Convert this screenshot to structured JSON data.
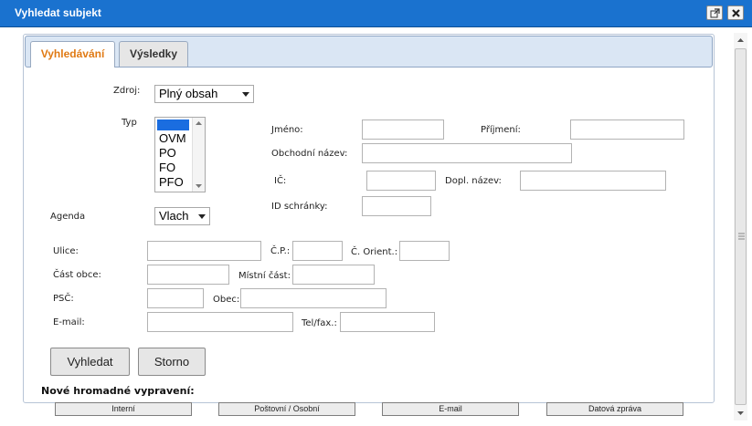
{
  "window": {
    "title": "Vyhledat subjekt"
  },
  "tabs": [
    {
      "label": "Vyhledávání"
    },
    {
      "label": "Výsledky"
    }
  ],
  "form": {
    "zdroj_label": "Zdroj:",
    "zdroj_value": "Plný obsah",
    "typ_label": "Typ",
    "typ_options": [
      "",
      "OVM",
      "PO",
      "FO",
      "PFO"
    ],
    "agenda_label": "Agenda",
    "agenda_value": "Vlach",
    "jmeno_label": "Jméno:",
    "prijmeni_label": "Příjmení:",
    "obchodni_nazev_label": "Obchodní název:",
    "ic_label": "IČ:",
    "dopl_nazev_label": "Dopl. název:",
    "id_schranky_label": "ID schránky:",
    "ulice_label": "Ulice:",
    "cp_label": "Č.P.:",
    "c_orient_label": "Č. Orient.:",
    "cast_obce_label": "Část obce:",
    "mistni_cast_label": "Místní část:",
    "psc_label": "PSČ:",
    "obec_label": "Obec:",
    "email_label": "E-mail:",
    "telfax_label": "Tel/fax.:"
  },
  "buttons": {
    "search": "Vyhledat",
    "cancel": "Storno"
  },
  "bulk_section": {
    "heading": "Nové hromadné vypravení:",
    "buttons": [
      "Interní",
      "Poštovní / Osobní",
      "E-mail",
      "Datová zpráva"
    ]
  }
}
